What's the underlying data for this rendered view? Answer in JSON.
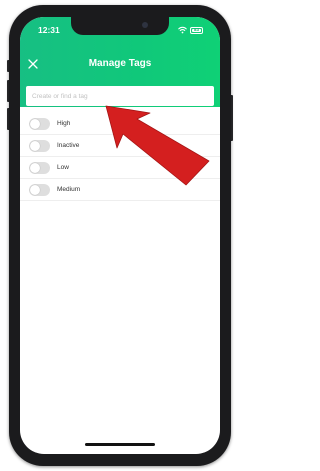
{
  "status_bar": {
    "time": "12:31",
    "battery_level": "83",
    "icons": [
      "wifi-icon",
      "battery-icon"
    ]
  },
  "header": {
    "title": "Manage Tags",
    "close_icon": "close-icon"
  },
  "search": {
    "placeholder": "Create or find a tag",
    "value": ""
  },
  "tags": [
    {
      "label": "High",
      "enabled": false
    },
    {
      "label": "Inactive",
      "enabled": false
    },
    {
      "label": "Low",
      "enabled": false
    },
    {
      "label": "Medium",
      "enabled": false
    }
  ],
  "annotation": {
    "type": "arrow",
    "color": "#d41f1f",
    "points_to": "search-input"
  },
  "colors": {
    "header_start": "#17bf83",
    "header_end": "#0fd176",
    "toggle_off": "#dedede"
  }
}
